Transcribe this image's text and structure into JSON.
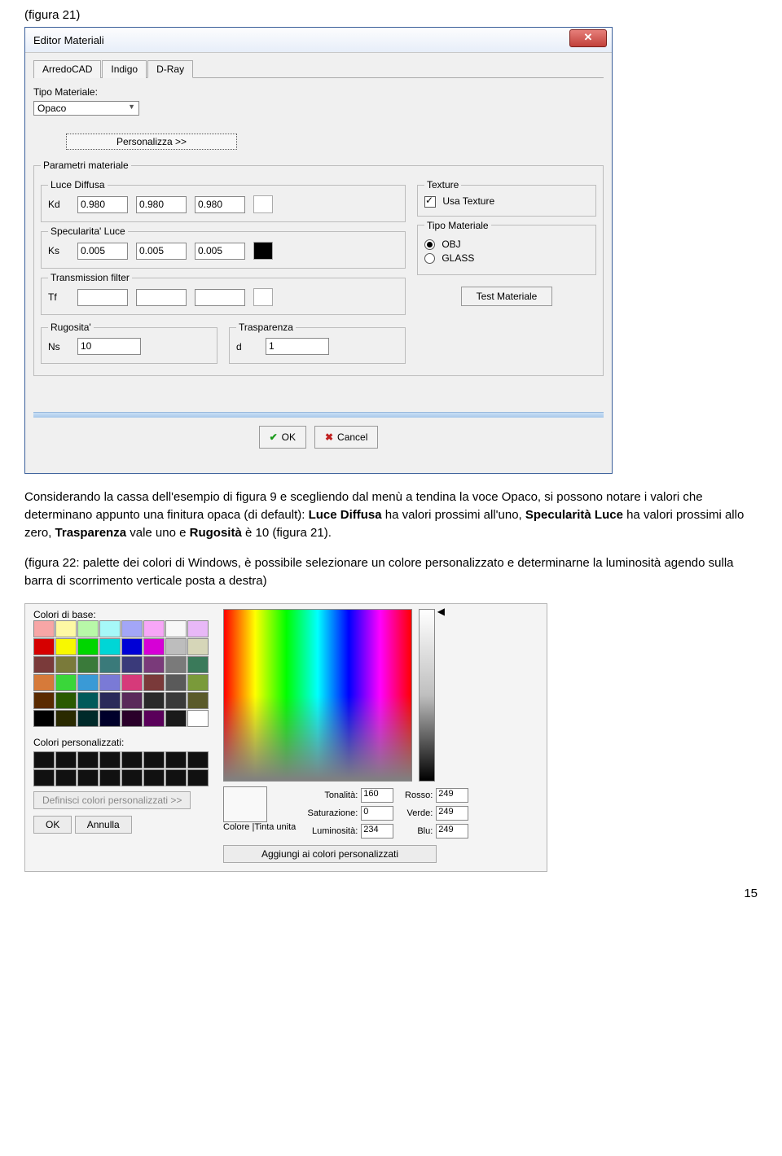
{
  "caption_top": "(figura 21)",
  "dialog1": {
    "title": "Editor Materiali",
    "tabs": [
      "ArredoCAD",
      "Indigo",
      "D-Ray"
    ],
    "tipo_materiale_label": "Tipo Materiale:",
    "tipo_materiale_value": "Opaco",
    "personalizza": "Personalizza >>",
    "group_params": "Parametri materiale",
    "luce_diffusa": {
      "legend": "Luce Diffusa",
      "k": "Kd",
      "v1": "0.980",
      "v2": "0.980",
      "v3": "0.980"
    },
    "specularita": {
      "legend": "Specularita' Luce",
      "k": "Ks",
      "v1": "0.005",
      "v2": "0.005",
      "v3": "0.005"
    },
    "transmission": {
      "legend": "Transmission filter",
      "k": "Tf"
    },
    "rugosita": {
      "legend": "Rugosita'",
      "k": "Ns",
      "v": "10"
    },
    "trasparenza": {
      "legend": "Trasparenza",
      "k": "d",
      "v": "1"
    },
    "texture": {
      "legend": "Texture",
      "use": "Usa Texture"
    },
    "tipo_mat2": {
      "legend": "Tipo Materiale",
      "opt1": "OBJ",
      "opt2": "GLASS"
    },
    "test_btn": "Test Materiale",
    "ok": "OK",
    "cancel": "Cancel"
  },
  "paragraph_html": {
    "p1a": "Considerando la cassa dell'esempio di figura 9 e scegliendo dal menù a tendina la voce Opaco, si possono notare i valori che determinano appunto una finitura opaca (di default): ",
    "b1": "Luce Diffusa",
    "p1b": " ha valori prossimi all'uno, ",
    "b2": "Specularità Luce",
    "p1c": " ha valori prossimi allo zero, ",
    "b3": "Trasparenza",
    "p1d": " vale uno e ",
    "b4": "Rugosità",
    "p1e": " è 10 (figura 21)."
  },
  "paragraph2": "(figura 22: palette dei colori di Windows, è possibile selezionare un colore personalizzato e determinarne la luminosità agendo sulla barra di scorrimento verticale posta a destra)",
  "picker": {
    "basic_label": "Colori di base:",
    "custom_label": "Colori personalizzati:",
    "define_btn": "Definisci colori personalizzati >>",
    "ok": "OK",
    "annulla": "Annulla",
    "colore_label": "Colore",
    "tinta_unita": "|Tinta unita",
    "tonalita": "Tonalità:",
    "saturazione": "Saturazione:",
    "luminosita": "Luminosità:",
    "rosso": "Rosso:",
    "verde": "Verde:",
    "blu": "Blu:",
    "ton_v": "160",
    "sat_v": "0",
    "lum_v": "234",
    "r_v": "249",
    "g_v": "249",
    "b_v": "249",
    "add": "Aggiungi ai colori personalizzati",
    "basic_colors": [
      "#f7a6a6",
      "#fdf8a4",
      "#b8f8a8",
      "#a6f8f8",
      "#a3a6f7",
      "#f7a6f7",
      "#f7f7f7",
      "#e8b8f7",
      "#d60000",
      "#f8f800",
      "#00d600",
      "#00d6d6",
      "#0000d6",
      "#d600d6",
      "#bdbdbd",
      "#d6d6b8",
      "#7a3a3a",
      "#7a7a3a",
      "#3a7a3a",
      "#3a7a7a",
      "#3a3a7a",
      "#7a3a7a",
      "#7a7a7a",
      "#3a7a5a",
      "#d67a3a",
      "#3ad63a",
      "#3a9ad6",
      "#7a7ad6",
      "#d63a7a",
      "#7a3a3a",
      "#5a5a5a",
      "#7a9a3a",
      "#5a2a00",
      "#2a5a00",
      "#005a5a",
      "#2a2a5a",
      "#5a2a5a",
      "#2a2a2a",
      "#3a3a3a",
      "#5a5a2a",
      "#000000",
      "#2a2a00",
      "#002a2a",
      "#00002a",
      "#2a002a",
      "#5a005a",
      "#1a1a1a",
      "#ffffff"
    ]
  },
  "page_number": "15"
}
